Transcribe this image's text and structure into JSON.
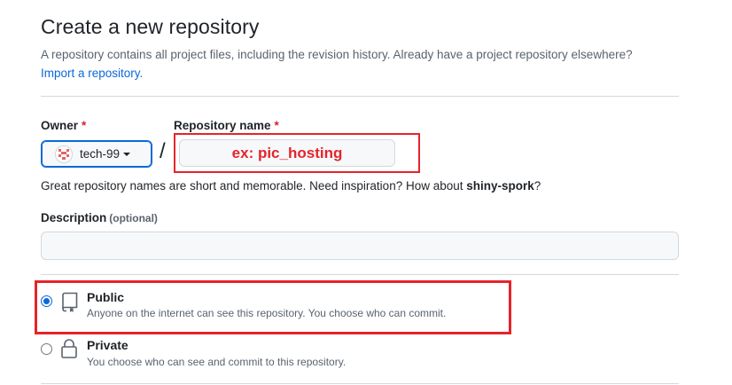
{
  "header": {
    "title": "Create a new repository",
    "subtitle": "A repository contains all project files, including the revision history. Already have a project repository elsewhere?",
    "import_link": "Import a repository."
  },
  "owner": {
    "label": "Owner",
    "required_mark": "*",
    "value": "tech-99"
  },
  "separator": "/",
  "repo_name": {
    "label": "Repository name",
    "required_mark": "*",
    "annotation": "ex: pic_hosting"
  },
  "hint": {
    "text": "Great repository names are short and memorable. Need inspiration? How about",
    "suggestion": "shiny-spork",
    "suffix": "?"
  },
  "description": {
    "label": "Description",
    "optional": "(optional)",
    "value": ""
  },
  "visibility": {
    "public": {
      "title": "Public",
      "desc": "Anyone on the internet can see this repository. You choose who can commit.",
      "checked": true
    },
    "private": {
      "title": "Private",
      "desc": "You choose who can see and commit to this repository.",
      "checked": false
    }
  },
  "colors": {
    "accent": "#0969da",
    "annotation_red": "#e5242a",
    "required_red": "#d1242f"
  },
  "icons": {
    "avatar": "identicon-avatar",
    "public": "repo-icon",
    "private": "lock-icon"
  }
}
